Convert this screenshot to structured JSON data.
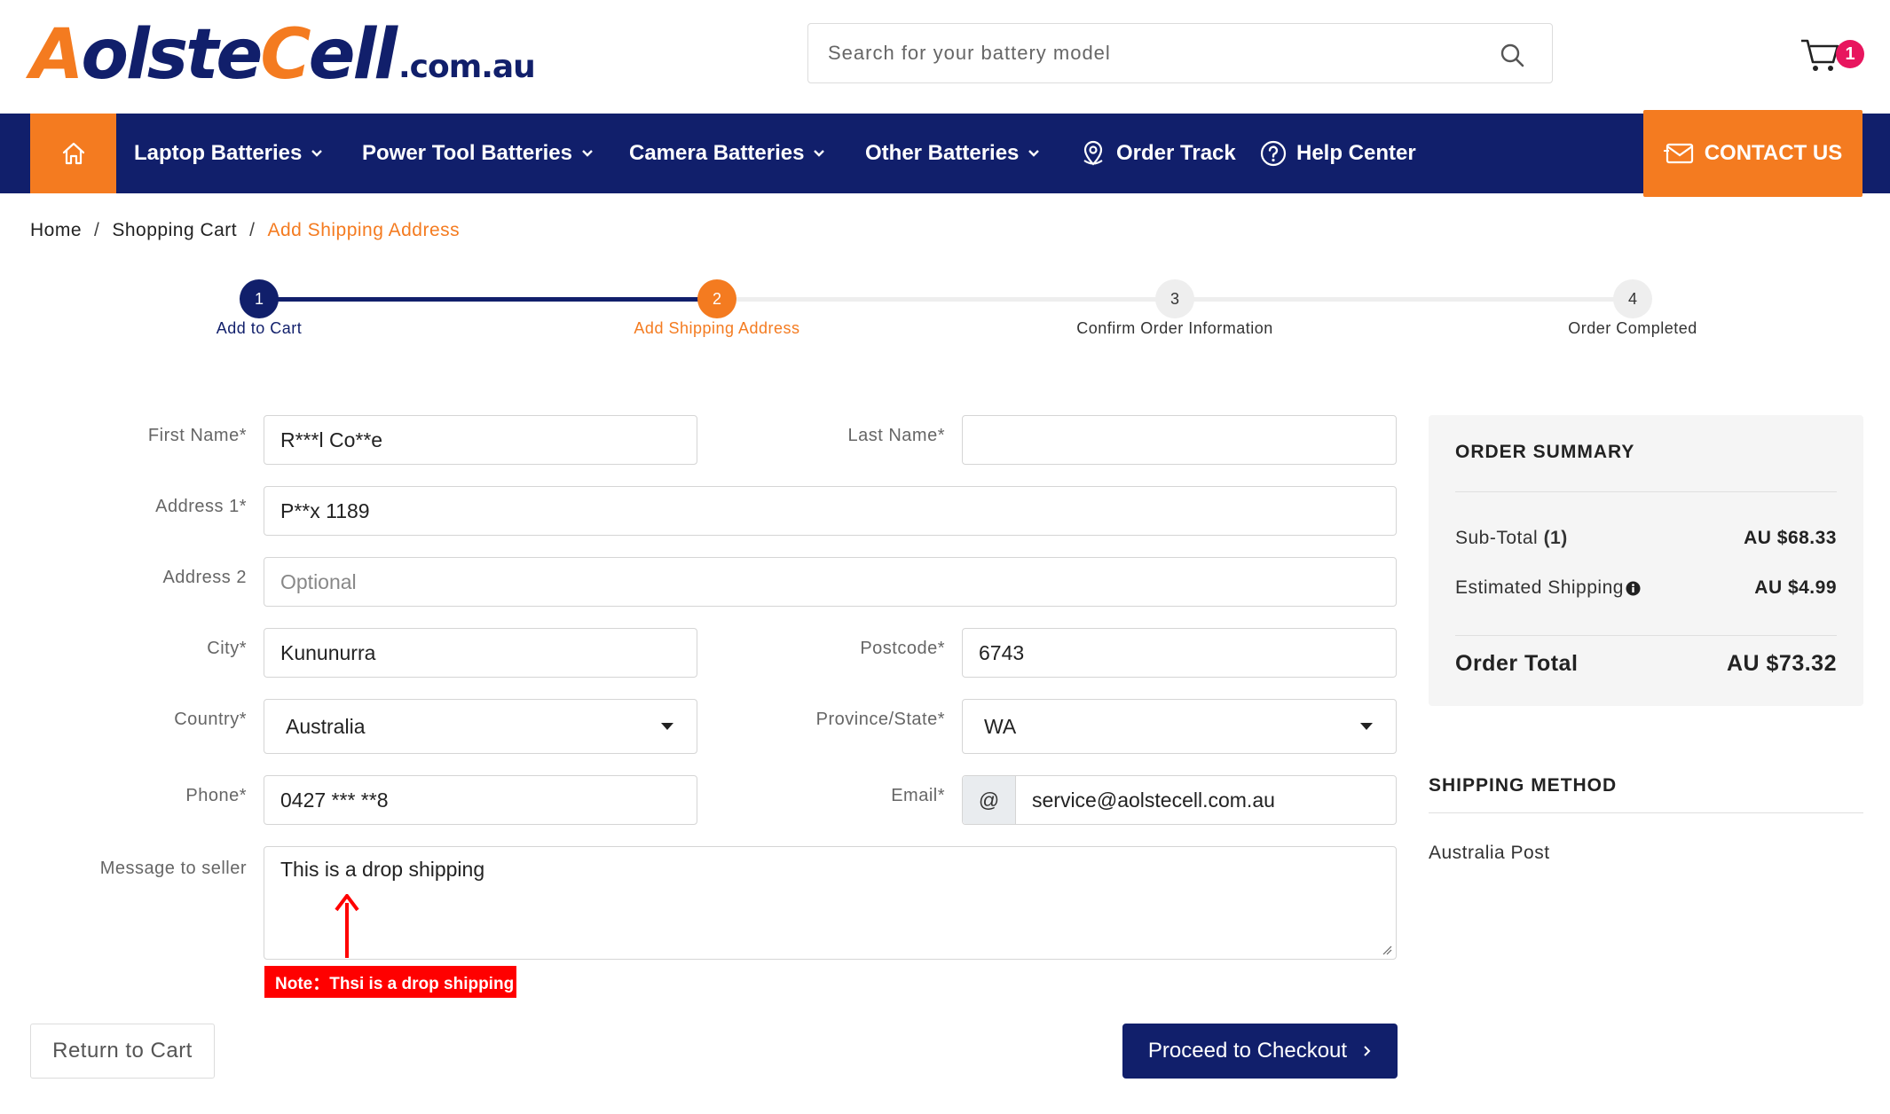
{
  "header": {
    "logo_text": "AolsteCell",
    "logo_domain": ".com.au",
    "search_placeholder": "Search for your battery model",
    "cart_count": "1"
  },
  "nav": {
    "items": [
      {
        "label": "Laptop Batteries",
        "dropdown": true
      },
      {
        "label": "Power Tool Batteries",
        "dropdown": true
      },
      {
        "label": "Camera Batteries",
        "dropdown": true
      },
      {
        "label": "Other Batteries",
        "dropdown": true
      },
      {
        "label": "Order Track",
        "icon": "location-pin-icon"
      },
      {
        "label": "Help Center",
        "icon": "question-circle-icon"
      }
    ],
    "contact_label": "CONTACT US"
  },
  "breadcrumb": {
    "home": "Home",
    "cart": "Shopping Cart",
    "current": "Add Shipping Address",
    "separator": "/"
  },
  "steps": [
    {
      "number": "1",
      "label": "Add to Cart",
      "state": "done"
    },
    {
      "number": "2",
      "label": "Add Shipping Address",
      "state": "active"
    },
    {
      "number": "3",
      "label": "Confirm Order Information",
      "state": "pending"
    },
    {
      "number": "4",
      "label": "Order Completed",
      "state": "pending"
    }
  ],
  "form": {
    "first_name": {
      "label": "First Name*",
      "value": "R***l Co**e"
    },
    "last_name": {
      "label": "Last Name*",
      "value": ""
    },
    "address1": {
      "label": "Address 1*",
      "value": "P**x 1189"
    },
    "address2": {
      "label": "Address 2",
      "placeholder": "Optional"
    },
    "city": {
      "label": "City*",
      "value": "Kununurra"
    },
    "postcode": {
      "label": "Postcode*",
      "value": "6743"
    },
    "country": {
      "label": "Country*",
      "value": "Australia"
    },
    "state": {
      "label": "Province/State*",
      "value": "WA"
    },
    "phone": {
      "label": "Phone*",
      "value": "0427 *** **8"
    },
    "email": {
      "label": "Email*",
      "prefix": "@",
      "value": "service@aolstecell.com.au"
    },
    "message": {
      "label": "Message to seller",
      "value": "This is a drop shipping"
    }
  },
  "annotation": {
    "note": "Note：Thsi is a drop shipping",
    "arrow_color": "#ff0000"
  },
  "buttons": {
    "return": "Return to Cart",
    "proceed": "Proceed to Checkout"
  },
  "summary": {
    "title": "ORDER SUMMARY",
    "subtotal_label": "Sub-Total",
    "subtotal_count": "(1)",
    "subtotal_value": "AU $68.33",
    "shipping_label": "Estimated Shipping",
    "shipping_value": "AU $4.99",
    "total_label": "Order Total",
    "total_value": "AU $73.32"
  },
  "shipping_method": {
    "title": "SHIPPING METHOD",
    "value": "Australia Post"
  },
  "colors": {
    "brand_navy": "#111f6b",
    "brand_orange": "#f47b20",
    "badge_pink": "#e8155e",
    "note_red": "#ff0000"
  }
}
